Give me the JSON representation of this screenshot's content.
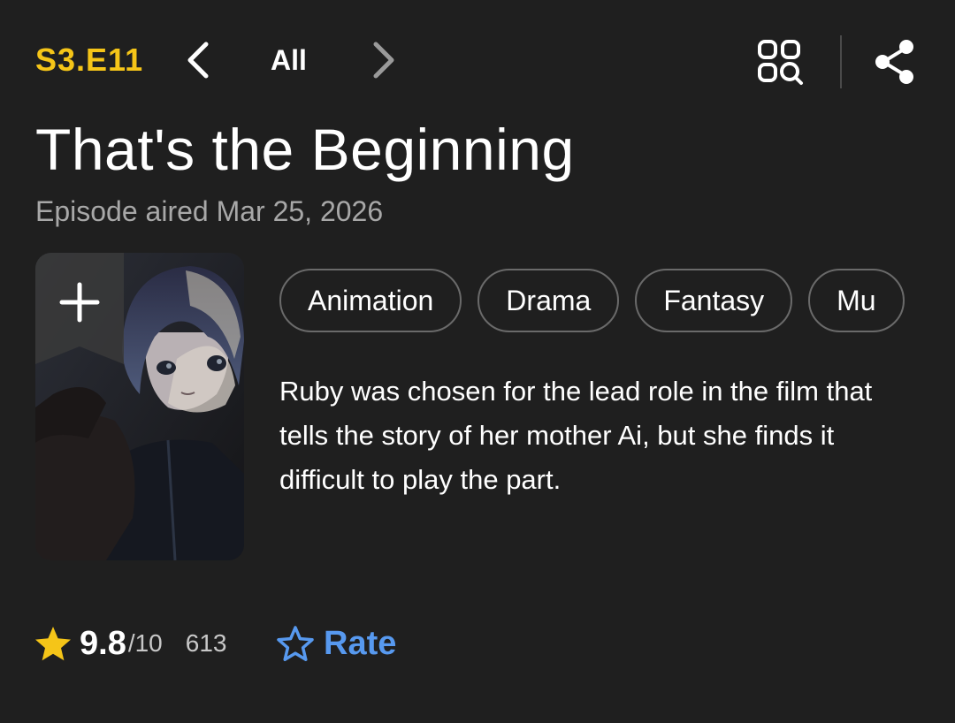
{
  "header": {
    "episode_code": "S3.E11",
    "nav_label": "All",
    "prev_icon": "chevron-left-icon",
    "next_icon": "chevron-right-icon",
    "browse_icon": "browse-episodes-icon",
    "share_icon": "share-icon"
  },
  "episode": {
    "title": "That's the Beginning",
    "aired": "Episode aired Mar 25, 2026",
    "description": "Ruby was chosen for the lead role in the film that tells the story of her mother Ai, but she finds it difficult to play the part."
  },
  "genres": [
    "Animation",
    "Drama",
    "Fantasy",
    "Mu"
  ],
  "rating": {
    "value": "9.8",
    "max": "/10",
    "count": "613",
    "rate_label": "Rate"
  },
  "colors": {
    "background": "#1f1f1f",
    "accent_yellow": "#f5c518",
    "link_blue": "#5799ef",
    "muted_text": "#a8a8a8"
  }
}
